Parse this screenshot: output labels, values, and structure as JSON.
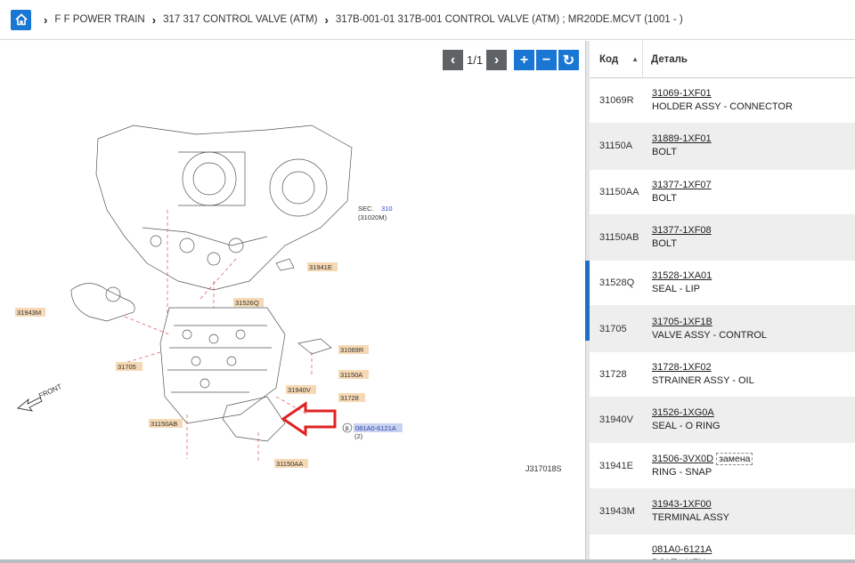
{
  "breadcrumb": [
    "F F POWER TRAIN",
    "317 317 CONTROL VALVE (ATM)",
    "317B-001-01 317B-001 CONTROL VALVE (ATM) ; MR20DE.MCVT (1001 - )"
  ],
  "toolbar": {
    "page_current": "1",
    "page_total": "1",
    "prev": "‹",
    "next": "›",
    "zoom_in": "+",
    "zoom_out": "−",
    "reset": "↻"
  },
  "diagram": {
    "labels": [
      "31941E",
      "31943M",
      "31526Q",
      "31069R",
      "31705",
      "31150A",
      "31940V",
      "31728",
      "31150AB",
      "081A0-6121A",
      "31150AA"
    ],
    "sec_label": "SEC.",
    "sec_num": "310",
    "sec_sub": "(31020M)",
    "front": "FRONT",
    "qty": "(2)",
    "b_marker": "B",
    "figure_id": "J317018S"
  },
  "table": {
    "col_code": "Код",
    "col_detail": "Деталь",
    "rows": [
      {
        "code": "31069R",
        "part": "31069-1XF01",
        "name": "HOLDER ASSY - CONNECTOR",
        "note": ""
      },
      {
        "code": "31150A",
        "part": "31889-1XF01",
        "name": "BOLT",
        "note": ""
      },
      {
        "code": "31150AA",
        "part": "31377-1XF07",
        "name": "BOLT",
        "note": ""
      },
      {
        "code": "31150AB",
        "part": "31377-1XF08",
        "name": "BOLT",
        "note": ""
      },
      {
        "code": "31528Q",
        "part": "31528-1XA01",
        "name": "SEAL - LIP",
        "note": ""
      },
      {
        "code": "31705",
        "part": "31705-1XF1B",
        "name": "VALVE ASSY - CONTROL",
        "note": ""
      },
      {
        "code": "31728",
        "part": "31728-1XF02",
        "name": "STRAINER ASSY - OIL",
        "note": ""
      },
      {
        "code": "31940V",
        "part": "31526-1XG0A",
        "name": "SEAL - O RING",
        "note": ""
      },
      {
        "code": "31941E",
        "part": "31506-3VX0D",
        "name": "RING - SNAP",
        "note": "замена"
      },
      {
        "code": "31943M",
        "part": "31943-1XF00",
        "name": "TERMINAL ASSY",
        "note": ""
      },
      {
        "code": "",
        "part": "081A0-6121A",
        "name": "BOLT - HEX",
        "note": ""
      }
    ]
  },
  "colors": {
    "accent": "#1976d2",
    "label_bg": "#f6d9b4",
    "arrow": "#e02020"
  }
}
